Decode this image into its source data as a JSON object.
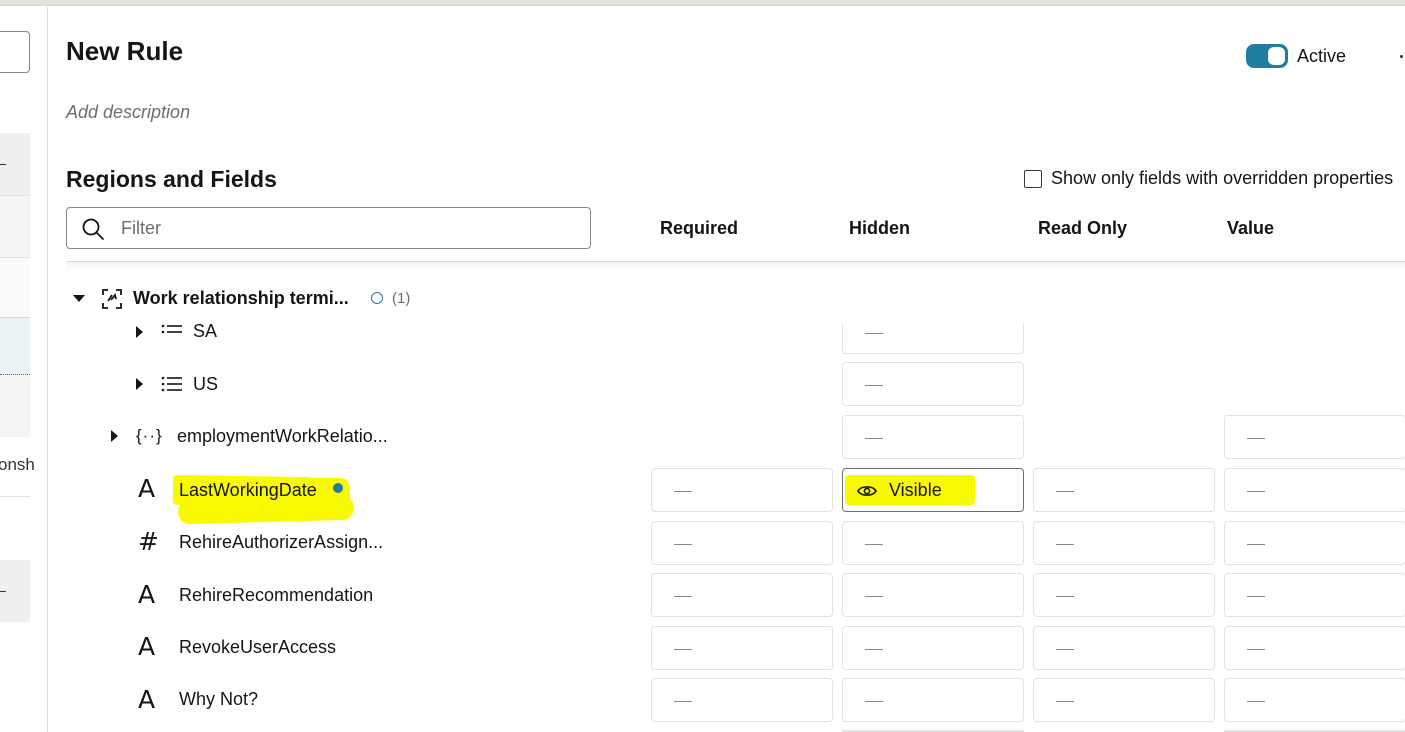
{
  "page": {
    "title": "New Rule",
    "description_placeholder": "Add description",
    "status_label": "Active",
    "status_on": true
  },
  "left_panel": {
    "partial_text": "onsh"
  },
  "regions": {
    "title": "Regions and Fields",
    "override_checkbox_label": "Show only fields with overridden properties",
    "override_checked": false,
    "filter_placeholder": "Filter",
    "columns": [
      "Required",
      "Hidden",
      "Read Only",
      "Value"
    ]
  },
  "tree": {
    "group": {
      "label": "Work relationship termi...",
      "count": "(1)"
    },
    "rows": [
      {
        "label": "SA",
        "icon": "list-icon",
        "hidden": "—"
      },
      {
        "label": "US",
        "icon": "list-icon",
        "hidden": "—"
      },
      {
        "label": "employmentWorkRelatio...",
        "icon": "braces-icon",
        "hidden": "—",
        "value": "—"
      },
      {
        "label": "LastWorkingDate",
        "icon": "text-icon",
        "required": "—",
        "hidden": "Visible",
        "read_only": "—",
        "value": "—"
      },
      {
        "label": "RehireAuthorizerAssign...",
        "icon": "number-icon",
        "required": "—",
        "hidden": "—",
        "read_only": "—",
        "value": "—"
      },
      {
        "label": "RehireRecommendation",
        "icon": "text-icon",
        "required": "—",
        "hidden": "—",
        "read_only": "—",
        "value": "—"
      },
      {
        "label": "RevokeUserAccess",
        "icon": "text-icon",
        "required": "—",
        "hidden": "—",
        "read_only": "—",
        "value": "—"
      },
      {
        "label": "Why Not?",
        "icon": "text-icon",
        "required": "—",
        "hidden": "—",
        "read_only": "—",
        "value": "—"
      }
    ]
  },
  "colors": {
    "accent": "#227e9e",
    "highlight": "#f9f900"
  }
}
